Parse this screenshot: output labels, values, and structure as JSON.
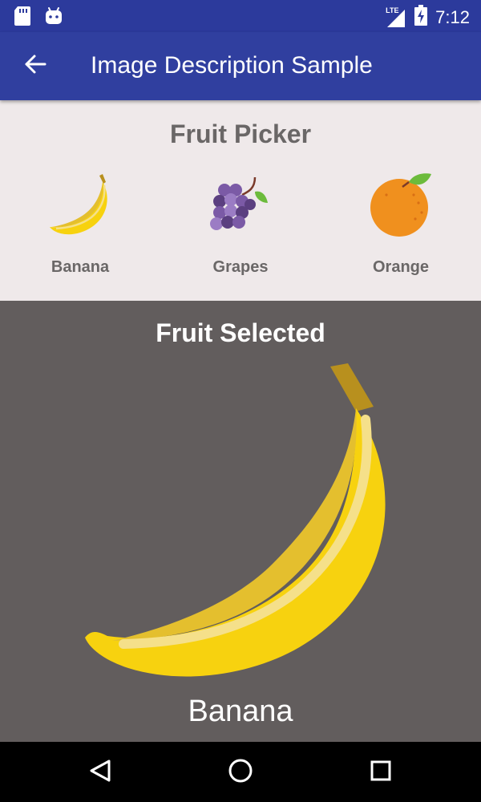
{
  "status_bar": {
    "time": "7:12",
    "network": "LTE",
    "icons": [
      "sd-card-icon",
      "android-icon",
      "signal-icon",
      "battery-charging-icon"
    ]
  },
  "app_bar": {
    "title": "Image Description Sample",
    "back_icon": "arrow-left-icon"
  },
  "picker": {
    "title": "Fruit Picker",
    "items": [
      {
        "label": "Banana",
        "icon": "banana-icon"
      },
      {
        "label": "Grapes",
        "icon": "grapes-icon"
      },
      {
        "label": "Orange",
        "icon": "orange-icon"
      }
    ]
  },
  "selected": {
    "title": "Fruit Selected",
    "name": "Banana",
    "image": "banana-icon"
  },
  "nav_bar": {
    "icons": [
      "back-triangle-icon",
      "home-circle-icon",
      "recents-square-icon"
    ]
  },
  "colors": {
    "status_bar": "#2c3a9c",
    "app_bar": "#303f9f",
    "picker_bg": "#efe9ea",
    "selected_bg": "#625d5d",
    "banana": "#f7d20f",
    "grape": "#7b5aa6",
    "orange": "#f0901e"
  }
}
